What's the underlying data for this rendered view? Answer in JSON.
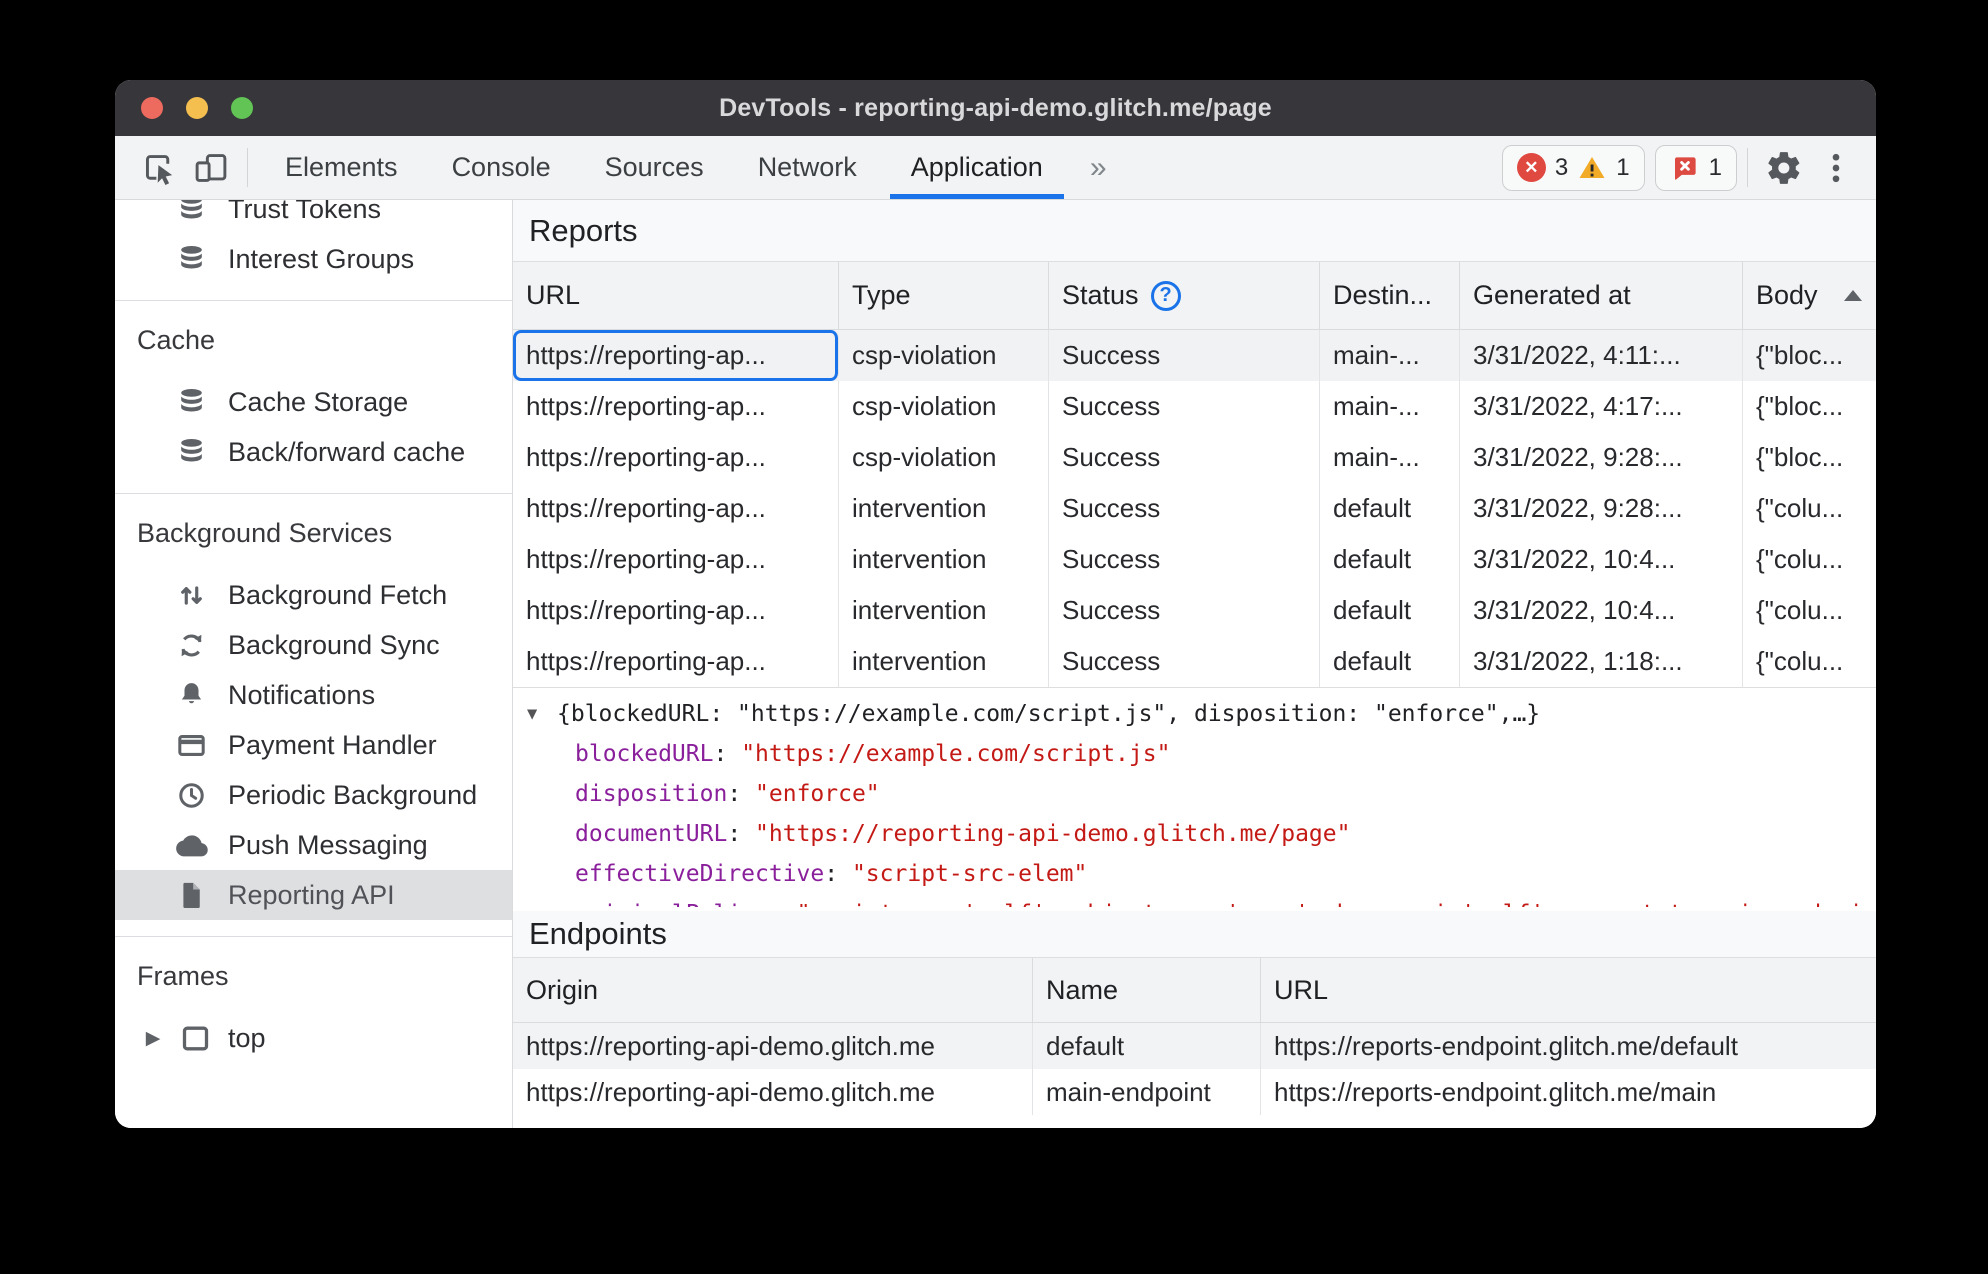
{
  "colors": {
    "accent_blue": "#1a73e8",
    "error_red": "#df4940",
    "warning_yellow": "#f2ab26",
    "issues_red": "#dc4a41",
    "json_key_purple": "#8a1f9b",
    "json_string_red": "#c41a16",
    "titlebar": "#37373b",
    "traffic_red": "#ed6a5e",
    "traffic_yellow": "#f4bf4f",
    "traffic_green": "#61c454",
    "selected_sidebar_bg": "#dedfe1"
  },
  "icons": {
    "more_tabs": "»",
    "error_x": "✕",
    "help": "?",
    "disclosure_expanded": "▼",
    "disclosure_collapsed": "▶"
  },
  "window": {
    "title": "DevTools - reporting-api-demo.glitch.me/page"
  },
  "toolbar": {
    "tabs": [
      {
        "label": "Elements"
      },
      {
        "label": "Console"
      },
      {
        "label": "Sources"
      },
      {
        "label": "Network"
      },
      {
        "label": "Application"
      }
    ],
    "error_count": "3",
    "warning_count": "1",
    "issues_count": "1"
  },
  "sidebar": {
    "trust_tokens": "Trust Tokens",
    "interest_groups": "Interest Groups",
    "cache_header": "Cache",
    "cache_storage": "Cache Storage",
    "back_forward_cache": "Back/forward cache",
    "background_services_header": "Background Services",
    "background_fetch": "Background Fetch",
    "background_sync": "Background Sync",
    "notifications": "Notifications",
    "payment_handler": "Payment Handler",
    "periodic_background": "Periodic Background",
    "push_messaging": "Push Messaging",
    "reporting_api": "Reporting API",
    "frames_header": "Frames",
    "top_frame": "top"
  },
  "reports": {
    "title": "Reports",
    "columns": {
      "url": "URL",
      "type": "Type",
      "status": "Status",
      "destination": "Destin...",
      "generated": "Generated at",
      "body": "Body"
    },
    "rows": [
      {
        "url": "https://reporting-ap...",
        "type": "csp-violation",
        "status": "Success",
        "destination": "main-...",
        "generated": "3/31/2022, 4:11:...",
        "body": "{\"bloc..."
      },
      {
        "url": "https://reporting-ap...",
        "type": "csp-violation",
        "status": "Success",
        "destination": "main-...",
        "generated": "3/31/2022, 4:17:...",
        "body": "{\"bloc..."
      },
      {
        "url": "https://reporting-ap...",
        "type": "csp-violation",
        "status": "Success",
        "destination": "main-...",
        "generated": "3/31/2022, 9:28:...",
        "body": "{\"bloc..."
      },
      {
        "url": "https://reporting-ap...",
        "type": "intervention",
        "status": "Success",
        "destination": "default",
        "generated": "3/31/2022, 9:28:...",
        "body": "{\"colu..."
      },
      {
        "url": "https://reporting-ap...",
        "type": "intervention",
        "status": "Success",
        "destination": "default",
        "generated": "3/31/2022, 10:4...",
        "body": "{\"colu..."
      },
      {
        "url": "https://reporting-ap...",
        "type": "intervention",
        "status": "Success",
        "destination": "default",
        "generated": "3/31/2022, 10:4...",
        "body": "{\"colu..."
      },
      {
        "url": "https://reporting-ap...",
        "type": "intervention",
        "status": "Success",
        "destination": "default",
        "generated": "3/31/2022, 1:18:...",
        "body": "{\"colu..."
      }
    ]
  },
  "report_preview": {
    "summary": "{blockedURL: \"https://example.com/script.js\", disposition: \"enforce\",…}",
    "fields": [
      {
        "key": "blockedURL",
        "value": "\"https://example.com/script.js\""
      },
      {
        "key": "disposition",
        "value": "\"enforce\""
      },
      {
        "key": "documentURL",
        "value": "\"https://reporting-api-demo.glitch.me/page\""
      },
      {
        "key": "effectiveDirective",
        "value": "\"script-src-elem\""
      },
      {
        "key": "originalPolicy",
        "value": "\"script-src 'self'; object-src 'none'; base-uri 'self'; report-to main-endpoint; default-src 'self' https://reporting-api-demo.glitch.me\""
      }
    ]
  },
  "endpoints": {
    "title": "Endpoints",
    "columns": {
      "origin": "Origin",
      "name": "Name",
      "url": "URL"
    },
    "rows": [
      {
        "origin": "https://reporting-api-demo.glitch.me",
        "name": "default",
        "url": "https://reports-endpoint.glitch.me/default"
      },
      {
        "origin": "https://reporting-api-demo.glitch.me",
        "name": "main-endpoint",
        "url": "https://reports-endpoint.glitch.me/main"
      }
    ]
  }
}
